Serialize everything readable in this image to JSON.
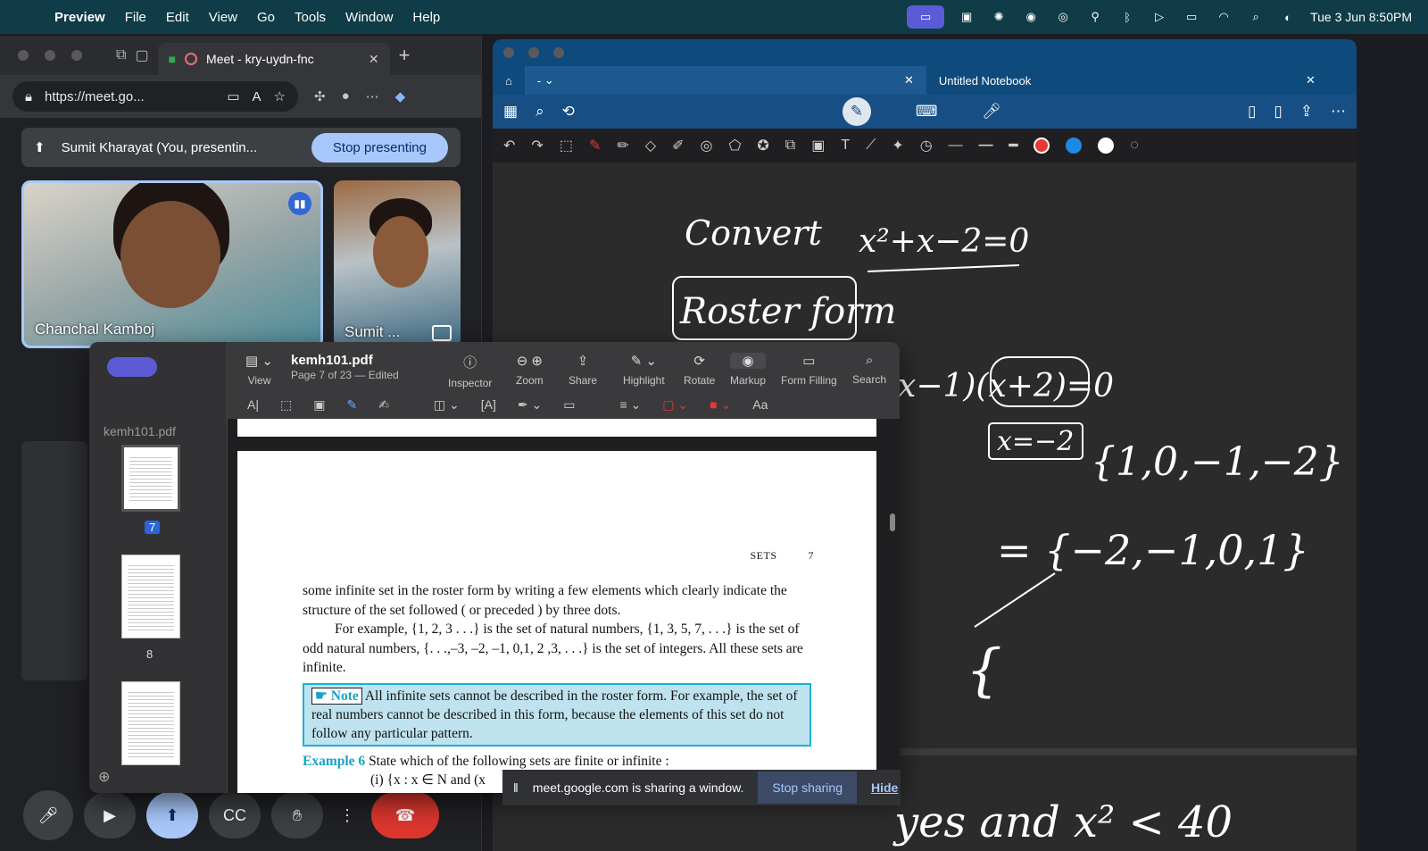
{
  "menubar": {
    "app": "Preview",
    "items": [
      "File",
      "Edit",
      "View",
      "Go",
      "Tools",
      "Window",
      "Help"
    ],
    "clock": "Tue 3 Jun  8:50PM"
  },
  "browser": {
    "tab_title": "Meet - kry-uydn-fnc",
    "url": "https://meet.go...",
    "presenting_text": "Sumit Kharayat (You, presentin...",
    "stop_presenting": "Stop presenting",
    "participant1": "Chanchal Kamboj",
    "participant2": "Sumit ..."
  },
  "notebook": {
    "tab_left": "-",
    "tab_title": "Untitled Notebook",
    "handwriting": {
      "line1": "Convert",
      "line2": "x²+x−2=0",
      "box1": "Roster form",
      "line3": "(x−1)(x+2)=0",
      "line4": "x=−2",
      "line5": "{1,0,−1,−2}",
      "line6": "= {−2,−1,0,1}",
      "line7": "{",
      "line8": "yes and x² < 40"
    },
    "accent_color": "#0f4a7d"
  },
  "preview": {
    "sidebar_label": "kemh101.pdf",
    "pages": [
      "7",
      "8"
    ],
    "doc_title": "kemh101.pdf",
    "doc_sub": "Page 7 of 23 — Edited",
    "toolbar": {
      "view": "View",
      "inspector": "Inspector",
      "zoom": "Zoom",
      "share": "Share",
      "highlight": "Highlight",
      "rotate": "Rotate",
      "markup": "Markup",
      "form_filling": "Form Filling",
      "search": "Search",
      "font": "Aa"
    },
    "page": {
      "running_head": "SETS",
      "page_no": "7",
      "para1": "some infinite set in the roster form by writing a few elements which clearly indicate the structure of the set followed ( or preceded ) by three dots.",
      "para2": "For example, {1, 2, 3 . . .} is the set of natural numbers, {1, 3, 5, 7, . . .} is the set of odd natural numbers, {. . .,–3, –2, –1, 0,1, 2 ,3, . . .} is the set of integers. All these sets are infinite.",
      "note_label": "Note",
      "note_text": "All infinite sets cannot be described in the roster form. For example, the set of real numbers cannot be described in this form, because the elements of this set do not follow any particular pattern.",
      "example_label": "Example 6",
      "example_text": "State which of the following sets are finite or infinite :",
      "example_item": "(i)    {x : x ∈ N and (x"
    }
  },
  "sharebar": {
    "text": "meet.google.com is sharing a window.",
    "stop": "Stop sharing",
    "hide": "Hide"
  }
}
